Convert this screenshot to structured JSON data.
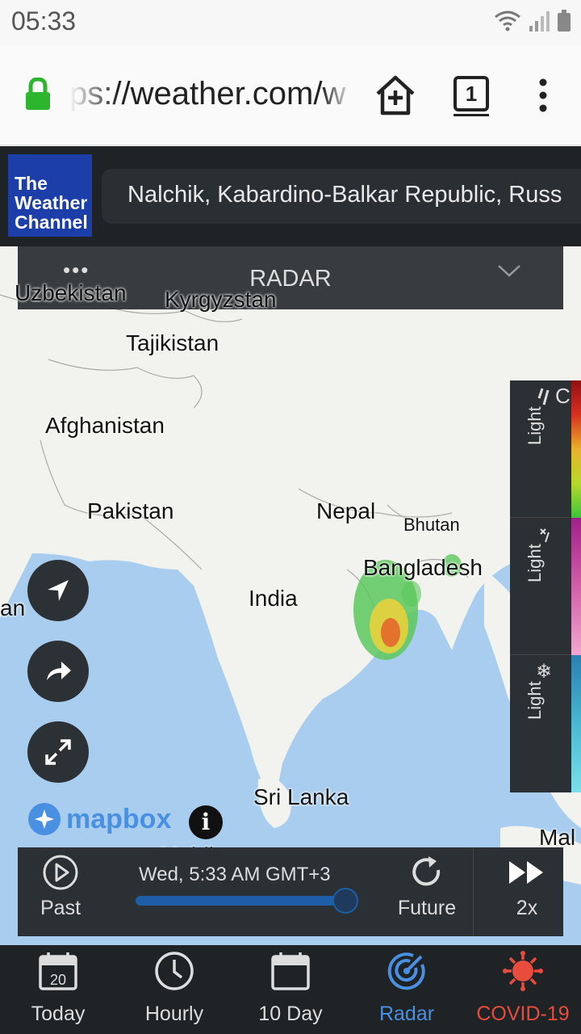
{
  "status": {
    "time": "05:33"
  },
  "browser": {
    "url": "ps://weather.com/w",
    "tab_count": "1"
  },
  "header": {
    "logo_lines": [
      "The",
      "Weather",
      "Channel"
    ],
    "location": "Nalchik, Kabardino-Balkar Republic, Russ"
  },
  "radar_tab": {
    "dots": "•••",
    "label": "RADAR"
  },
  "map_labels": {
    "uzbekistan": "Uzbekistan",
    "kyrgyzstan": "Kyrgyzstan",
    "tajikistan": "Tajikistan",
    "afghanistan": "Afghanistan",
    "pakistan": "Pakistan",
    "nepal": "Nepal",
    "bhutan": "Bhutan",
    "bangladesh": "Bangladesh",
    "india": "India",
    "oman_fragment": "an",
    "sri_lanka": "Sri Lanka",
    "maldives": "Maldives",
    "malaysia_fragment": "Mal"
  },
  "mapbox": {
    "label": "mapbox",
    "info": "i"
  },
  "legend": {
    "rain": "Light",
    "mix": "Light",
    "snow": "Light",
    "rain_fragment": "C"
  },
  "playback": {
    "past": "Past",
    "time": "Wed, 5:33 AM GMT+3",
    "future": "Future",
    "speed": "2x",
    "progress": 0.97
  },
  "nav": {
    "today_day": "20",
    "today": "Today",
    "hourly": "Hourly",
    "tenday": "10 Day",
    "radar": "Radar",
    "covid": "COVID-19"
  },
  "colors": {
    "accent": "#4a90e2",
    "covid": "#e84c3d",
    "logo": "#1b3ea8"
  }
}
